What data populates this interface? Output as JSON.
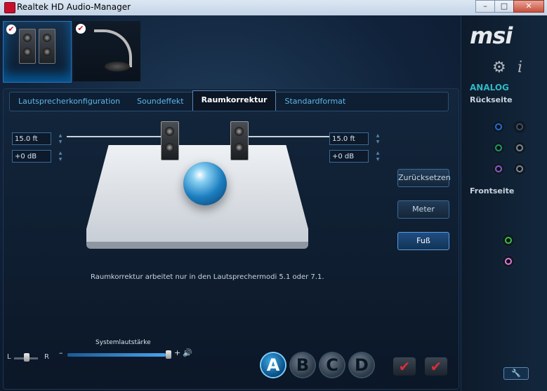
{
  "window": {
    "title": "Realtek HD Audio-Manager",
    "minimize": "–",
    "maximize": "□",
    "close": "✕"
  },
  "devices": {
    "check": "✔"
  },
  "sidebar": {
    "logo": "msi",
    "gear": "⚙",
    "info": "i",
    "analog": "ANALOG",
    "rear": "Rückseite",
    "front": "Frontseite",
    "wrench": "🔧",
    "rear_jacks": [
      "#1f6fd6",
      "#40505e",
      "#1f9a62",
      "#7e8a94",
      "#8c5bc8",
      "#7e8a94"
    ],
    "front_jacks": [
      "#3fbf3f",
      "#e07ad8"
    ]
  },
  "tabs": [
    "Lautsprecherkonfiguration",
    "Soundeffekt",
    "Raumkorrektur",
    "Standardformat"
  ],
  "room": {
    "left_distance": "15.0 ft",
    "left_gain": "+0 dB",
    "right_distance": "15.0 ft",
    "right_gain": "+0 dB",
    "note": "Raumkorrektur arbeitet nur in den Lautsprechermodi 5.1 oder 7.1."
  },
  "buttons": {
    "reset": "Zurücksetzen",
    "meter": "Meter",
    "foot": "Fuß"
  },
  "bottom": {
    "balance_left": "L",
    "balance_right": "R",
    "volume_title": "Systemlautstärke",
    "minus": "–",
    "plus": "+",
    "speaker": "🔊",
    "a": "A",
    "b": "B",
    "c": "C",
    "d": "D",
    "check": "✔",
    "check2": "✔"
  },
  "arrows": {
    "up": "▲",
    "down": "▼"
  }
}
